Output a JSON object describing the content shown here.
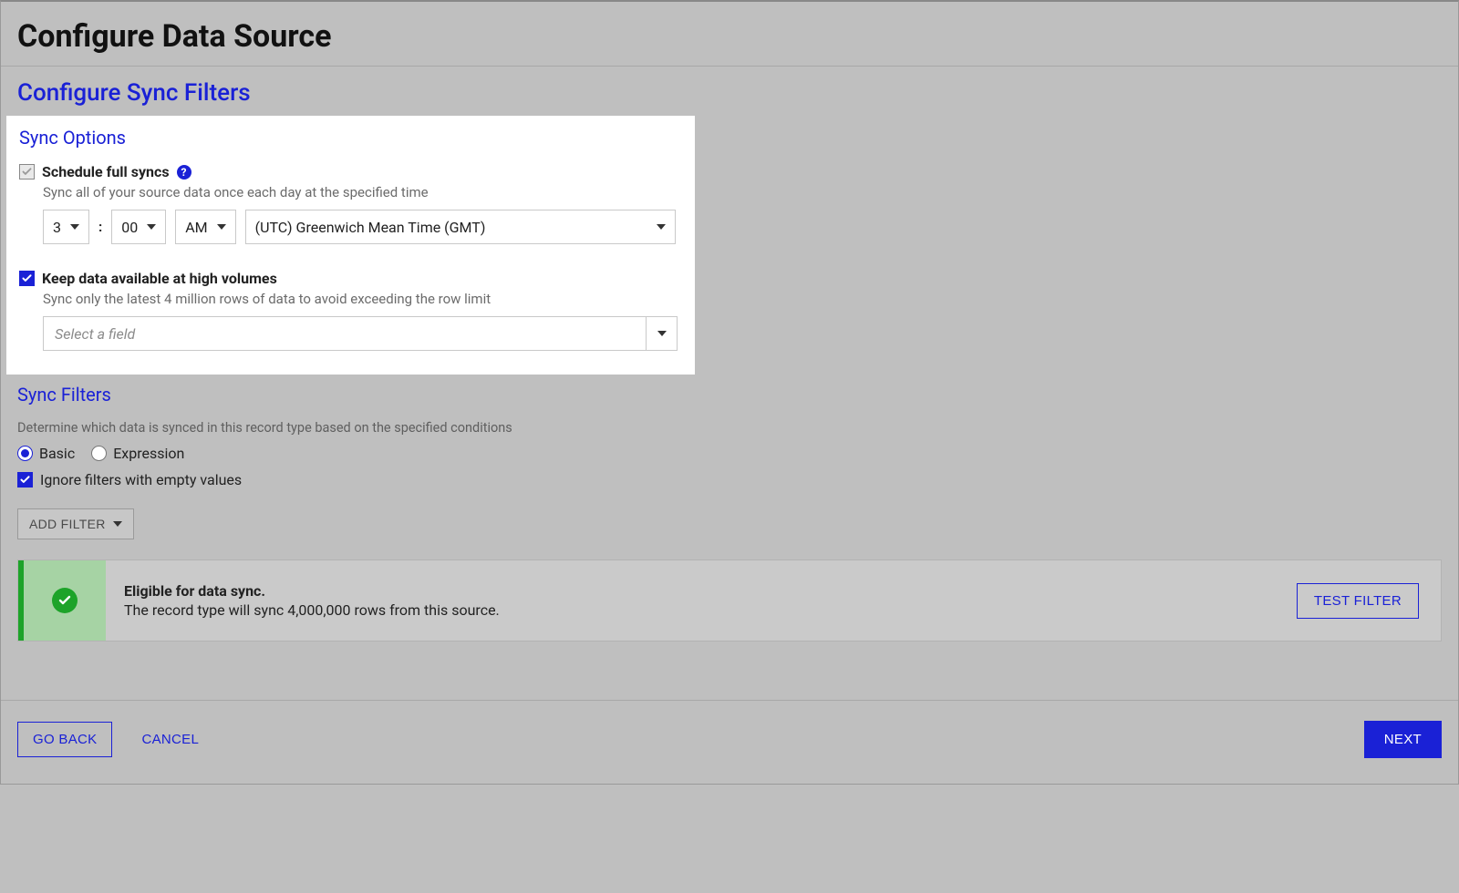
{
  "header": {
    "title": "Configure Data Source"
  },
  "subtitle": "Configure Sync Filters",
  "sync_options": {
    "heading": "Sync Options",
    "schedule": {
      "label": "Schedule full syncs",
      "desc": "Sync all of your source data once each day at the specified time",
      "hour": "3",
      "minute": "00",
      "ampm": "AM",
      "timezone": "(UTC) Greenwich Mean Time (GMT)"
    },
    "high_volume": {
      "label": "Keep data available at high volumes",
      "desc": "Sync only the latest 4 million rows of data to avoid exceeding the row limit",
      "field_placeholder": "Select a field"
    }
  },
  "sync_filters": {
    "heading": "Sync Filters",
    "desc": "Determine which data is synced in this record type based on the specified conditions",
    "mode_basic": "Basic",
    "mode_expression": "Expression",
    "ignore_empty": "Ignore filters with empty values",
    "add_filter": "ADD FILTER"
  },
  "status": {
    "title": "Eligible for data sync.",
    "body": "The record type will sync 4,000,000 rows from this source.",
    "test_btn": "TEST FILTER"
  },
  "footer": {
    "go_back": "GO BACK",
    "cancel": "CANCEL",
    "next": "NEXT"
  }
}
